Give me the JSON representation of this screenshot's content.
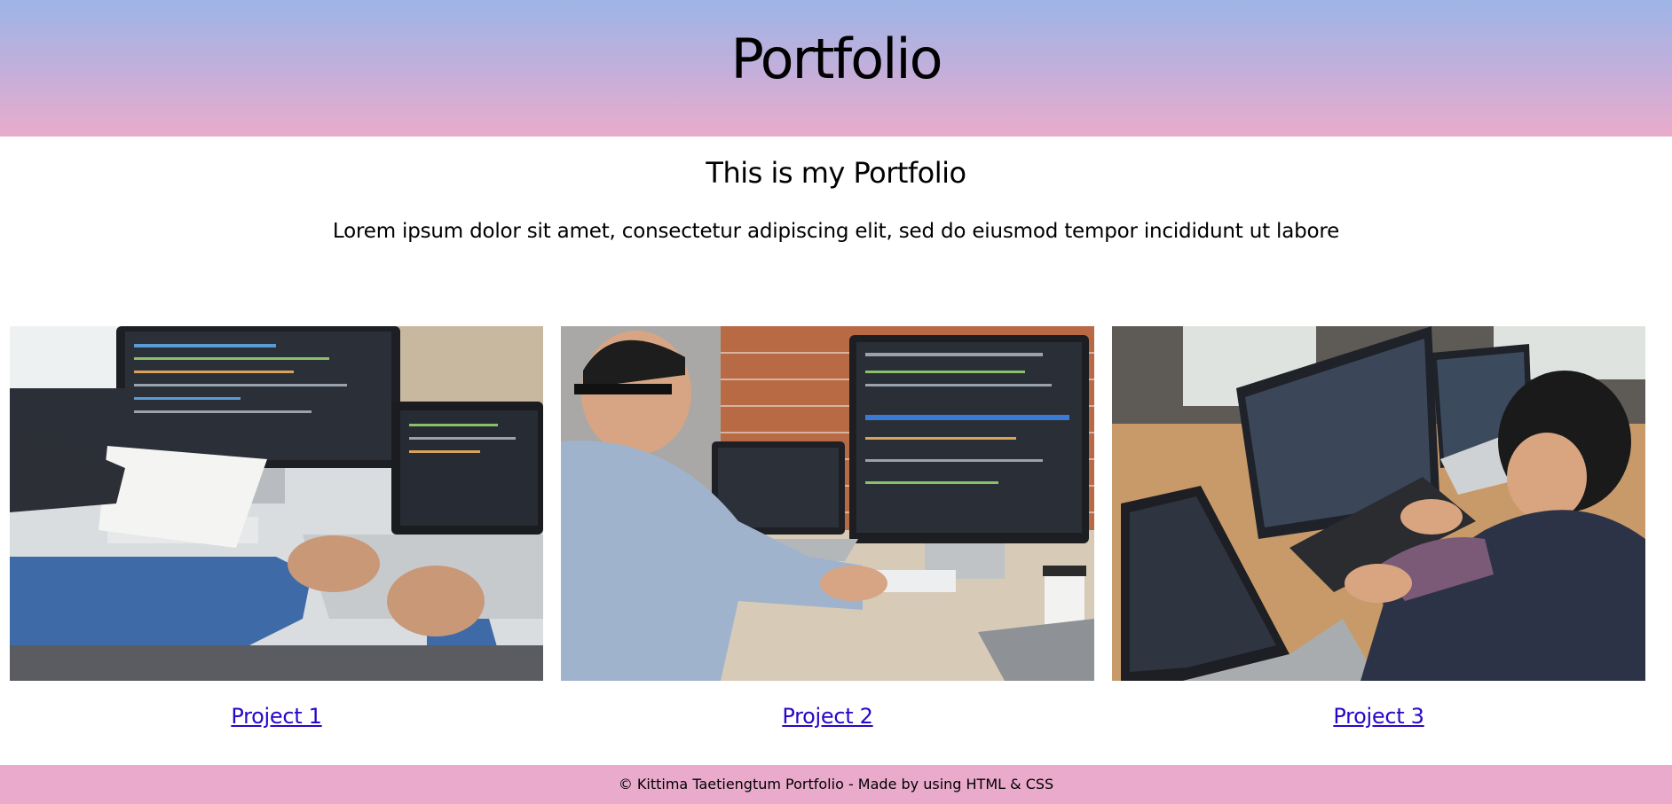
{
  "header": {
    "title": "Portfolio"
  },
  "intro": {
    "title": "This is my Portfolio",
    "text": "Lorem ipsum dolor sit amet, consectetur adipiscing elit, sed do eiusmod tempor incididunt ut labore"
  },
  "projects": [
    {
      "label": "Project 1",
      "image": "developers-working-at-desk-photo"
    },
    {
      "label": "Project 2",
      "image": "programmer-at-computer-photo"
    },
    {
      "label": "Project 3",
      "image": "developer-with-laptops-photo"
    }
  ],
  "footer": {
    "text": "© Kittima Taetiengtum Portfolio - Made by using HTML & CSS"
  },
  "colors": {
    "header_top": "#9db5e6",
    "header_bottom": "#e9accb",
    "footer_bg": "#e9aacb",
    "link": "#2a06c9"
  }
}
